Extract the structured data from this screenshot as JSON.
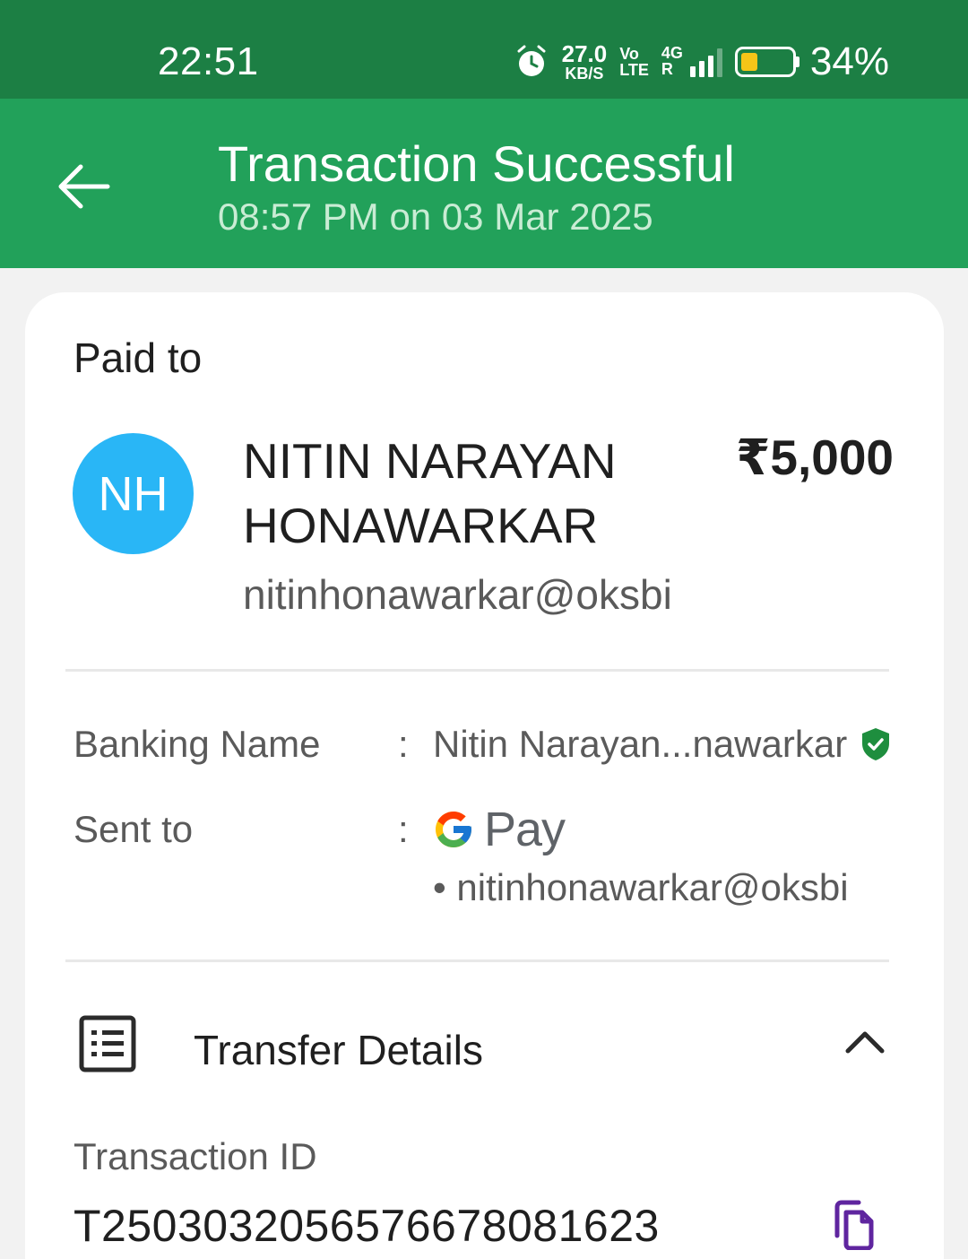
{
  "status_bar": {
    "time": "22:51",
    "net_speed_value": "27.0",
    "net_speed_unit": "KB/S",
    "volte_top": "Vo",
    "volte_bottom": "LTE",
    "network_type": "4G",
    "roaming": "R",
    "battery_percent": "34%",
    "battery_level": 0.34,
    "icons": [
      "alarm-icon",
      "signal-icon",
      "battery-icon"
    ]
  },
  "header": {
    "title": "Transaction Successful",
    "subtitle": "08:57 PM on 03 Mar 2025",
    "background": "#22a15a",
    "back_icon": "back-arrow-icon"
  },
  "paid_to": {
    "label": "Paid to",
    "avatar_initials": "NH",
    "avatar_color": "#29b6f6",
    "name": "NITIN NARAYAN HONAWARKAR",
    "amount": "₹5,000",
    "upi_id": "nitinhonawarkar@oksbi"
  },
  "details": {
    "banking_name_label": "Banking Name",
    "banking_name_value": "Nitin Narayan...nawarkar",
    "sent_to_label": "Sent to",
    "separator": ":",
    "sent_to_app": "Pay",
    "sent_to_upi": "• nitinhonawarkar@oksbi",
    "verified_color": "#1e8e3e"
  },
  "transfer": {
    "section_label": "Transfer Details",
    "transaction_id_label": "Transaction ID",
    "transaction_id": "T2503032056576678081623",
    "copy_icon_color": "#5f259f"
  }
}
